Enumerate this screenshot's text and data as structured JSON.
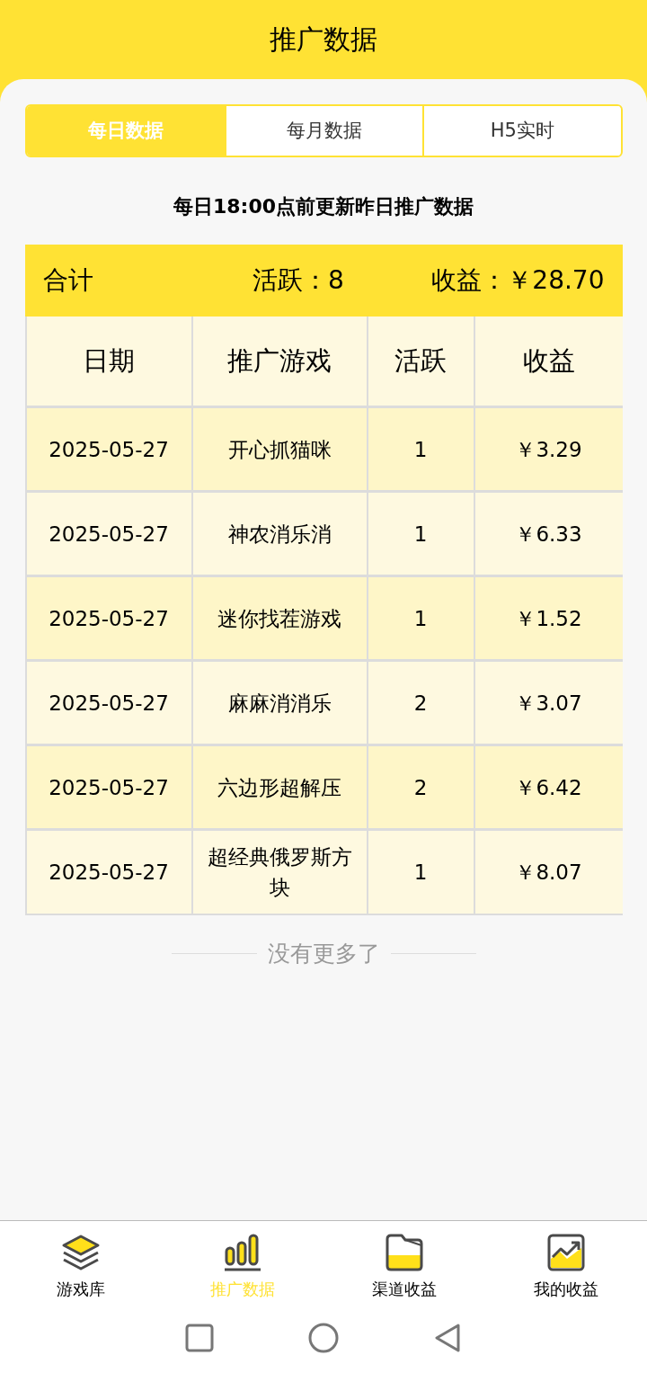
{
  "header": {
    "title": "推广数据"
  },
  "tabs": [
    {
      "label": "每日数据",
      "selected": true
    },
    {
      "label": "每月数据",
      "selected": false
    },
    {
      "label": "H5实时",
      "selected": false
    }
  ],
  "notice": "每日18:00点前更新昨日推广数据",
  "summary": {
    "label": "合计",
    "active": "活跃：8",
    "income": "收益：￥28.70"
  },
  "table": {
    "columns": [
      "日期",
      "推广游戏",
      "活跃",
      "收益"
    ],
    "rows": [
      [
        "2025-05-27",
        "开心抓猫咪",
        "1",
        "￥3.29"
      ],
      [
        "2025-05-27",
        "神农消乐消",
        "1",
        "￥6.33"
      ],
      [
        "2025-05-27",
        "迷你找茬游戏",
        "1",
        "￥1.52"
      ],
      [
        "2025-05-27",
        "麻麻消消乐",
        "2",
        "￥3.07"
      ],
      [
        "2025-05-27",
        "六边形超解压",
        "2",
        "￥6.42"
      ],
      [
        "2025-05-27",
        "超经典俄罗斯方块",
        "1",
        "￥8.07"
      ]
    ]
  },
  "end_text": "没有更多了",
  "bottom_nav": [
    {
      "label": "游戏库",
      "kind": "layers",
      "selected": false
    },
    {
      "label": "推广数据",
      "kind": "bars",
      "selected": true
    },
    {
      "label": "渠道收益",
      "kind": "folder",
      "selected": false
    },
    {
      "label": "我的收益",
      "kind": "trend",
      "selected": false
    }
  ]
}
